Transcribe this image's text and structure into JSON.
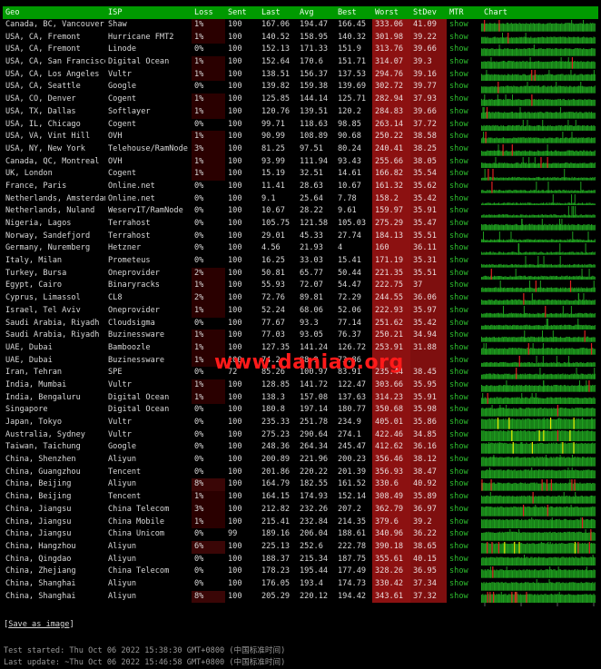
{
  "columns": {
    "geo": "Geo",
    "isp": "ISP",
    "loss": "Loss",
    "sent": "Sent",
    "last": "Last",
    "avg": "Avg",
    "best": "Best",
    "worst": "Worst",
    "stdev": "StDev",
    "mtr": "MTR",
    "chart": "Chart"
  },
  "rows": [
    {
      "geo": "Canada, BC, Vancouver",
      "isp": "Shaw",
      "loss": "1%",
      "sent": "100",
      "last": "167.06",
      "avg": "194.47",
      "best": "166.45",
      "worst": "333.06",
      "stdev": "41.09",
      "mtr": "show"
    },
    {
      "geo": "USA, CA, Fremont",
      "isp": "Hurricane FMT2",
      "loss": "1%",
      "sent": "100",
      "last": "140.52",
      "avg": "158.95",
      "best": "140.32",
      "worst": "301.98",
      "stdev": "39.22",
      "mtr": "show"
    },
    {
      "geo": "USA, CA, Fremont",
      "isp": "Linode",
      "loss": "0%",
      "sent": "100",
      "last": "152.13",
      "avg": "171.33",
      "best": "151.9",
      "worst": "313.76",
      "stdev": "39.66",
      "mtr": "show"
    },
    {
      "geo": "USA, CA, San Francisco",
      "isp": "Digital Ocean",
      "loss": "1%",
      "sent": "100",
      "last": "152.64",
      "avg": "170.6",
      "best": "151.71",
      "worst": "314.07",
      "stdev": "39.3",
      "mtr": "show"
    },
    {
      "geo": "USA, CA, Los Angeles",
      "isp": "Vultr",
      "loss": "1%",
      "sent": "100",
      "last": "138.51",
      "avg": "156.37",
      "best": "137.53",
      "worst": "294.76",
      "stdev": "39.16",
      "mtr": "show"
    },
    {
      "geo": "USA, CA, Seattle",
      "isp": "Google",
      "loss": "0%",
      "sent": "100",
      "last": "139.82",
      "avg": "159.38",
      "best": "139.69",
      "worst": "302.72",
      "stdev": "39.77",
      "mtr": "show"
    },
    {
      "geo": "USA, CO, Denver",
      "isp": "Cogent",
      "loss": "1%",
      "sent": "100",
      "last": "125.85",
      "avg": "144.14",
      "best": "125.71",
      "worst": "282.94",
      "stdev": "37.93",
      "mtr": "show"
    },
    {
      "geo": "USA, TX, Dallas",
      "isp": "Softlayer",
      "loss": "1%",
      "sent": "100",
      "last": "120.76",
      "avg": "139.51",
      "best": "120.2",
      "worst": "284.83",
      "stdev": "39.66",
      "mtr": "show"
    },
    {
      "geo": "USA, IL, Chicago",
      "isp": "Cogent",
      "loss": "0%",
      "sent": "100",
      "last": "99.71",
      "avg": "118.63",
      "best": "98.85",
      "worst": "263.14",
      "stdev": "37.72",
      "mtr": "show"
    },
    {
      "geo": "USA, VA, Vint Hill",
      "isp": "OVH",
      "loss": "1%",
      "sent": "100",
      "last": "90.99",
      "avg": "108.89",
      "best": "90.68",
      "worst": "250.22",
      "stdev": "38.58",
      "mtr": "show"
    },
    {
      "geo": "USA, NY, New York",
      "isp": "Telehouse/RamNode",
      "loss": "3%",
      "sent": "100",
      "last": "81.25",
      "avg": "97.51",
      "best": "80.24",
      "worst": "240.41",
      "stdev": "38.25",
      "mtr": "show"
    },
    {
      "geo": "Canada, QC, Montreal",
      "isp": "OVH",
      "loss": "1%",
      "sent": "100",
      "last": "93.99",
      "avg": "111.94",
      "best": "93.43",
      "worst": "255.66",
      "stdev": "38.05",
      "mtr": "show"
    },
    {
      "geo": "UK, London",
      "isp": "Cogent",
      "loss": "1%",
      "sent": "100",
      "last": "15.19",
      "avg": "32.51",
      "best": "14.61",
      "worst": "166.82",
      "stdev": "35.54",
      "mtr": "show"
    },
    {
      "geo": "France, Paris",
      "isp": "Online.net",
      "loss": "0%",
      "sent": "100",
      "last": "11.41",
      "avg": "28.63",
      "best": "10.67",
      "worst": "161.32",
      "stdev": "35.62",
      "mtr": "show"
    },
    {
      "geo": "Netherlands, Amsterdam",
      "isp": "Online.net",
      "loss": "0%",
      "sent": "100",
      "last": "9.1",
      "avg": "25.64",
      "best": "7.78",
      "worst": "158.2",
      "stdev": "35.42",
      "mtr": "show"
    },
    {
      "geo": "Netherlands, Nuland",
      "isp": "WeservIT/RamNode",
      "loss": "0%",
      "sent": "100",
      "last": "10.67",
      "avg": "28.22",
      "best": "9.61",
      "worst": "159.97",
      "stdev": "35.91",
      "mtr": "show"
    },
    {
      "geo": "Nigeria, Lagos",
      "isp": "Terrahost",
      "loss": "0%",
      "sent": "100",
      "last": "105.75",
      "avg": "121.58",
      "best": "105.03",
      "worst": "275.29",
      "stdev": "35.47",
      "mtr": "show"
    },
    {
      "geo": "Norway, Sandefjord",
      "isp": "Terrahost",
      "loss": "0%",
      "sent": "100",
      "last": "29.01",
      "avg": "45.33",
      "best": "27.74",
      "worst": "184.13",
      "stdev": "35.51",
      "mtr": "show"
    },
    {
      "geo": "Germany, Nuremberg",
      "isp": "Hetzner",
      "loss": "0%",
      "sent": "100",
      "last": "4.56",
      "avg": "21.93",
      "best": "4",
      "worst": "160",
      "stdev": "36.11",
      "mtr": "show"
    },
    {
      "geo": "Italy, Milan",
      "isp": "Prometeus",
      "loss": "0%",
      "sent": "100",
      "last": "16.25",
      "avg": "33.03",
      "best": "15.41",
      "worst": "171.19",
      "stdev": "35.31",
      "mtr": "show"
    },
    {
      "geo": "Turkey, Bursa",
      "isp": "Oneprovider",
      "loss": "2%",
      "sent": "100",
      "last": "50.81",
      "avg": "65.77",
      "best": "50.44",
      "worst": "221.35",
      "stdev": "35.51",
      "mtr": "show"
    },
    {
      "geo": "Egypt, Cairo",
      "isp": "Binaryracks",
      "loss": "1%",
      "sent": "100",
      "last": "55.93",
      "avg": "72.07",
      "best": "54.47",
      "worst": "222.75",
      "stdev": "37",
      "mtr": "show"
    },
    {
      "geo": "Cyprus, Limassol",
      "isp": "CL8",
      "loss": "2%",
      "sent": "100",
      "last": "72.76",
      "avg": "89.81",
      "best": "72.29",
      "worst": "244.55",
      "stdev": "36.06",
      "mtr": "show"
    },
    {
      "geo": "Israel, Tel Aviv",
      "isp": "Oneprovider",
      "loss": "1%",
      "sent": "100",
      "last": "52.24",
      "avg": "68.06",
      "best": "52.06",
      "worst": "222.93",
      "stdev": "35.97",
      "mtr": "show"
    },
    {
      "geo": "Saudi Arabia, Riyadh",
      "isp": "Cloudsigma",
      "loss": "0%",
      "sent": "100",
      "last": "77.67",
      "avg": "93.3",
      "best": "77.14",
      "worst": "251.62",
      "stdev": "35.42",
      "mtr": "show"
    },
    {
      "geo": "Saudi Arabia, Riyadh",
      "isp": "Buzinessware",
      "loss": "1%",
      "sent": "100",
      "last": "77.03",
      "avg": "93.05",
      "best": "76.37",
      "worst": "250.21",
      "stdev": "34.94",
      "mtr": "show"
    },
    {
      "geo": "UAE, Dubai",
      "isp": "Bamboozle",
      "loss": "1%",
      "sent": "100",
      "last": "127.35",
      "avg": "141.24",
      "best": "126.72",
      "worst": "253.91",
      "stdev": "31.88",
      "mtr": "show"
    },
    {
      "geo": "UAE, Dubai",
      "isp": "Buzinessware",
      "loss": "1%",
      "sent": "100",
      "last": "74.2",
      "avg": "88.9",
      "best": "73.86",
      "worst": "",
      "stdev": "",
      "mtr": "show"
    },
    {
      "geo": "Iran, Tehran",
      "isp": "SPE",
      "loss": "0%",
      "sent": "72",
      "last": "85.26",
      "avg": "100.97",
      "best": "83.91",
      "worst": "235.44",
      "stdev": "38.45",
      "mtr": "show"
    },
    {
      "geo": "India, Mumbai",
      "isp": "Vultr",
      "loss": "1%",
      "sent": "100",
      "last": "128.85",
      "avg": "141.72",
      "best": "122.47",
      "worst": "303.66",
      "stdev": "35.95",
      "mtr": "show"
    },
    {
      "geo": "India, Bengaluru",
      "isp": "Digital Ocean",
      "loss": "1%",
      "sent": "100",
      "last": "138.3",
      "avg": "157.08",
      "best": "137.63",
      "worst": "314.23",
      "stdev": "35.91",
      "mtr": "show"
    },
    {
      "geo": "Singapore",
      "isp": "Digital Ocean",
      "loss": "0%",
      "sent": "100",
      "last": "180.8",
      "avg": "197.14",
      "best": "180.77",
      "worst": "350.68",
      "stdev": "35.98",
      "mtr": "show"
    },
    {
      "geo": "Japan, Tokyo",
      "isp": "Vultr",
      "loss": "0%",
      "sent": "100",
      "last": "235.33",
      "avg": "251.78",
      "best": "234.9",
      "worst": "405.01",
      "stdev": "35.86",
      "mtr": "show"
    },
    {
      "geo": "Australia, Sydney",
      "isp": "Vultr",
      "loss": "0%",
      "sent": "100",
      "last": "275.23",
      "avg": "290.64",
      "best": "274.1",
      "worst": "422.46",
      "stdev": "34.85",
      "mtr": "show"
    },
    {
      "geo": "Taiwan, Taichung",
      "isp": "Google",
      "loss": "0%",
      "sent": "100",
      "last": "248.36",
      "avg": "264.34",
      "best": "245.47",
      "worst": "412.62",
      "stdev": "36.16",
      "mtr": "show"
    },
    {
      "geo": "China, Shenzhen",
      "isp": "Aliyun",
      "loss": "0%",
      "sent": "100",
      "last": "200.89",
      "avg": "221.96",
      "best": "200.23",
      "worst": "356.46",
      "stdev": "38.12",
      "mtr": "show"
    },
    {
      "geo": "China, Guangzhou",
      "isp": "Tencent",
      "loss": "0%",
      "sent": "100",
      "last": "201.86",
      "avg": "220.22",
      "best": "201.39",
      "worst": "356.93",
      "stdev": "38.47",
      "mtr": "show"
    },
    {
      "geo": "China, Beijing",
      "isp": "Aliyun",
      "loss": "8%",
      "sent": "100",
      "last": "164.79",
      "avg": "182.55",
      "best": "161.52",
      "worst": "330.6",
      "stdev": "40.92",
      "mtr": "show"
    },
    {
      "geo": "China, Beijing",
      "isp": "Tencent",
      "loss": "1%",
      "sent": "100",
      "last": "164.15",
      "avg": "174.93",
      "best": "152.14",
      "worst": "308.49",
      "stdev": "35.89",
      "mtr": "show"
    },
    {
      "geo": "China, Jiangsu",
      "isp": "China Telecom",
      "loss": "3%",
      "sent": "100",
      "last": "212.82",
      "avg": "232.26",
      "best": "207.2",
      "worst": "362.79",
      "stdev": "36.97",
      "mtr": "show"
    },
    {
      "geo": "China, Jiangsu",
      "isp": "China Mobile",
      "loss": "1%",
      "sent": "100",
      "last": "215.41",
      "avg": "232.84",
      "best": "214.35",
      "worst": "379.6",
      "stdev": "39.2",
      "mtr": "show"
    },
    {
      "geo": "China, Jiangsu",
      "isp": "China Unicom",
      "loss": "0%",
      "sent": "99",
      "last": "189.16",
      "avg": "206.04",
      "best": "188.61",
      "worst": "340.96",
      "stdev": "36.22",
      "mtr": "show"
    },
    {
      "geo": "China, Hangzhou",
      "isp": "Aliyun",
      "loss": "6%",
      "sent": "100",
      "last": "225.13",
      "avg": "252.6",
      "best": "222.78",
      "worst": "390.18",
      "stdev": "38.65",
      "mtr": "show"
    },
    {
      "geo": "China, Qingdao",
      "isp": "Aliyun",
      "loss": "0%",
      "sent": "100",
      "last": "188.37",
      "avg": "215.34",
      "best": "187.75",
      "worst": "355.61",
      "stdev": "40.15",
      "mtr": "show"
    },
    {
      "geo": "China, Zhejiang",
      "isp": "China Telecom",
      "loss": "0%",
      "sent": "100",
      "last": "178.23",
      "avg": "195.44",
      "best": "177.49",
      "worst": "328.26",
      "stdev": "36.95",
      "mtr": "show"
    },
    {
      "geo": "China, Shanghai",
      "isp": "Aliyun",
      "loss": "0%",
      "sent": "100",
      "last": "176.05",
      "avg": "193.4",
      "best": "174.73",
      "worst": "330.42",
      "stdev": "37.34",
      "mtr": "show"
    },
    {
      "geo": "China, Shanghai",
      "isp": "Aliyun",
      "loss": "8%",
      "sent": "100",
      "last": "205.29",
      "avg": "220.12",
      "best": "194.42",
      "worst": "343.61",
      "stdev": "37.32",
      "mtr": "show"
    }
  ],
  "save_label": "Save as image",
  "test_started": "Test started: Thu Oct 06 2022 15:38:30 GMT+0800 (中国标准时间)",
  "last_update": "Last update: ~Thu Oct 06 2022 15:46:58 GMT+0800 (中国标准时间)",
  "watermark": "www.daniao.org",
  "colors": {
    "header_green": "#009a00",
    "worst_bg": "#8c1111",
    "stdev_bg": "#7e0f0f",
    "link_green": "#2fbf2f",
    "bar_green": "#1f9f1f",
    "spike_red": "#e02020",
    "spike_yellow": "#e6e600",
    "watermark": "#ff1a1a"
  }
}
